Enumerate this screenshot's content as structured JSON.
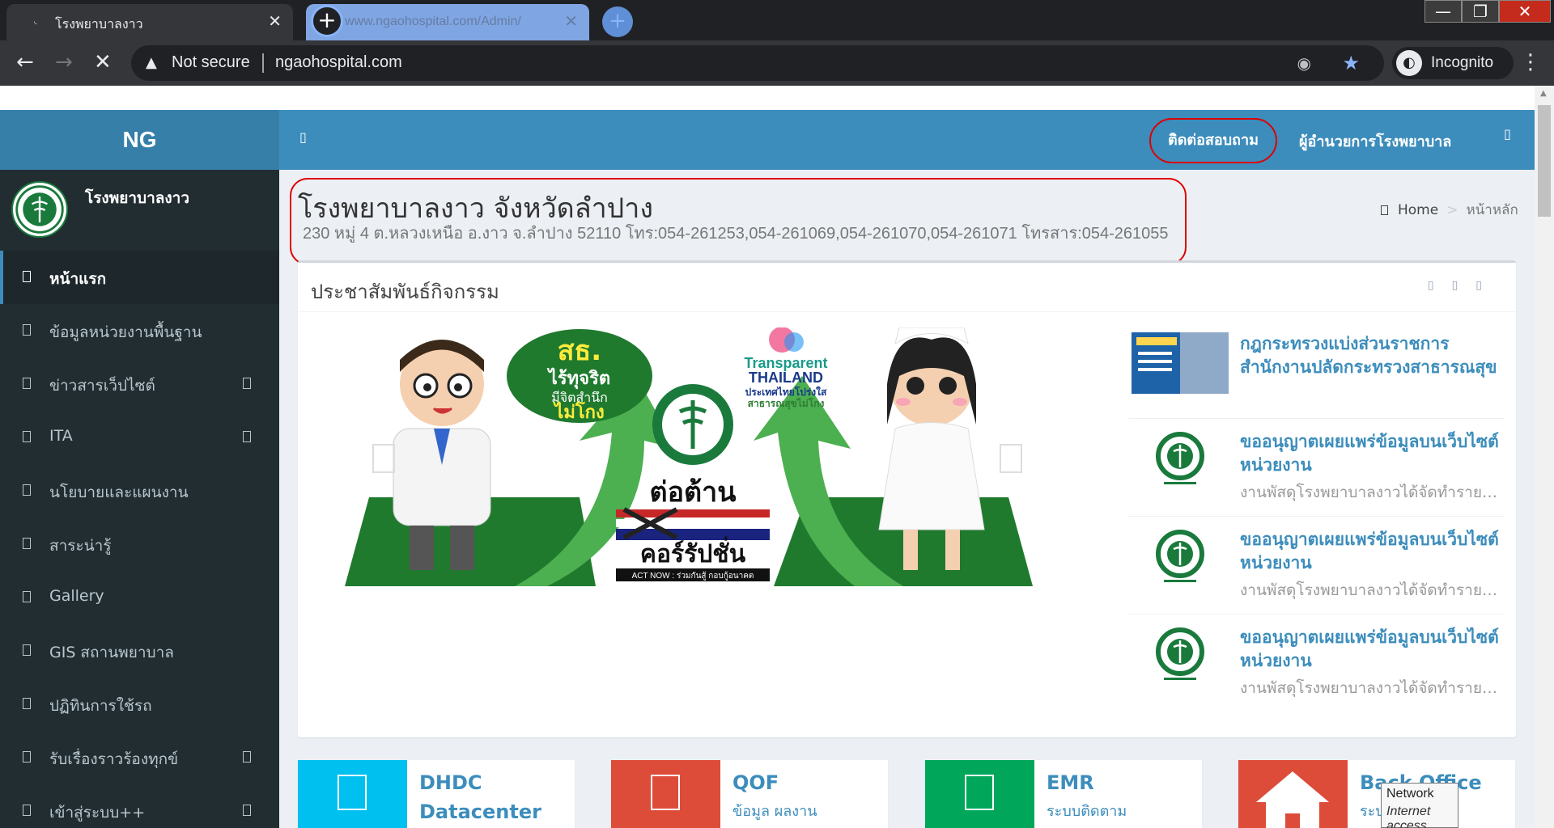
{
  "browser": {
    "active_tab_title": "โรงพยาบาลงาว",
    "inactive_tab_title": "www.ngaohospital.com/Admin/",
    "security_label": "Not secure",
    "url": "ngaohospital.com",
    "incognito_label": "Incognito"
  },
  "site": {
    "logo_text": "NG",
    "hospital_name": "โรงพยาบาลงาว",
    "nav_contact": "ติดต่อสอบถาม",
    "nav_director": "ผู้อำนวยการโรงพยาบาล"
  },
  "sidebar": {
    "items": [
      {
        "label": "หน้าแรก",
        "active": true,
        "has_children": false
      },
      {
        "label": "ข้อมูลหน่วยงานพื้นฐาน",
        "active": false,
        "has_children": false
      },
      {
        "label": "ข่าวสารเว็ปไซต์",
        "active": false,
        "has_children": true
      },
      {
        "label": "ITA",
        "active": false,
        "has_children": true
      },
      {
        "label": "นโยบายและแผนงาน",
        "active": false,
        "has_children": false
      },
      {
        "label": "สาระน่ารู้",
        "active": false,
        "has_children": false
      },
      {
        "label": "Gallery",
        "active": false,
        "has_children": false
      },
      {
        "label": "GIS สถานพยาบาล",
        "active": false,
        "has_children": false
      },
      {
        "label": "ปฏิทินการใช้รถ",
        "active": false,
        "has_children": false
      },
      {
        "label": "รับเรื่องราวร้องทุกข์",
        "active": false,
        "has_children": true
      },
      {
        "label": "เข้าสู่ระบบ++",
        "active": false,
        "has_children": true
      }
    ]
  },
  "header": {
    "title": "โรงพยาบาลงาว จังหวัดลำปาง",
    "subtitle": "230 หมู่ 4 ต.หลวงเหนือ อ.งาว จ.ลำปาง 52110 โทร:054-261253,054-261069,054-261070,054-261071 โทรสาร:054-261055",
    "breadcrumb_home": "Home",
    "breadcrumb_current": "หน้าหลัก"
  },
  "activities": {
    "box_title": "ประชาสัมพันธ์กิจกรรม",
    "banner": {
      "left_bubble": [
        "สธ.",
        "ไร้ทุจริต",
        "มีจิตสำนึก",
        "ไม่โกง"
      ],
      "transparent_title": [
        "Transparent",
        "THAILAND"
      ],
      "transparent_sub": [
        "ประเทศไทยโปร่งใส",
        "สาธารณสุขไม่โกง"
      ],
      "anti_title": [
        "ต่อต้าน",
        "คอร์รัปชั่น"
      ],
      "act_now": "ACT NOW : ร่วมกันสู้ กอบกู้อนาคต"
    },
    "news": [
      {
        "title": "กฎกระทรวงแบ่งส่วนราชการ สำนักงานปลัดกระทรวงสาธารณสุข",
        "desc": ""
      },
      {
        "title": "ขออนุญาตเผยแพร่ข้อมูลบนเว็บไซต์หน่วยงาน",
        "desc": "งานพัสดุโรงพยาบาลงาวได้จัดทำรายงาน"
      },
      {
        "title": "ขออนุญาตเผยแพร่ข้อมูลบนเว็บไซต์หน่วยงาน",
        "desc": "งานพัสดุโรงพยาบาลงาวได้จัดทำรายงาน"
      },
      {
        "title": "ขออนุญาตเผยแพร่ข้อมูลบนเว็บไซต์หน่วยงาน",
        "desc": "งานพัสดุโรงพยาบาลงาวได้จัดทำรายงาน"
      }
    ]
  },
  "tiles": [
    {
      "title": "DHDC",
      "sub": "Datacenter",
      "color": "#00c0ef"
    },
    {
      "title": "QOF",
      "sub": "ข้อมูล ผลงาน",
      "color": "#dd4b39"
    },
    {
      "title": "EMR",
      "sub": "ระบบติดตาม",
      "color": "#00a65a"
    },
    {
      "title": "Back Office",
      "sub": "ระบบ",
      "color": "#dd4b39"
    }
  ],
  "network_popup": {
    "title": "Network",
    "status": "Internet access"
  },
  "colors": {
    "topbar": "#3c8dbc",
    "sidebar": "#222d32",
    "highlight": "#dd0000"
  }
}
